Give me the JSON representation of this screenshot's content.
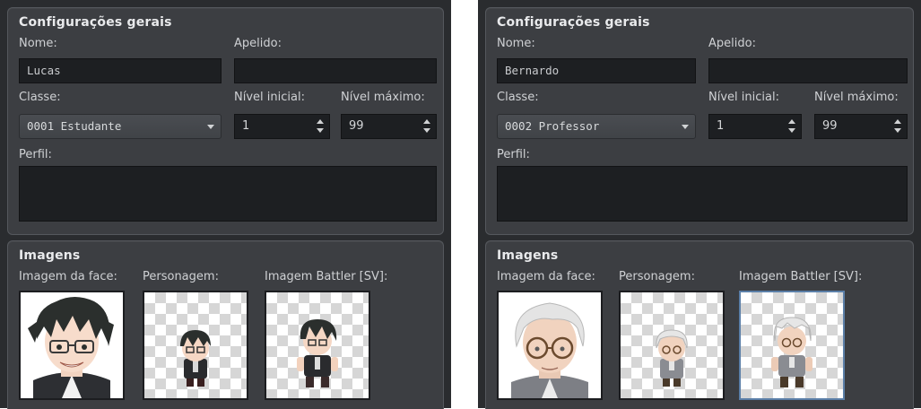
{
  "panels": [
    {
      "general": {
        "title": "Configurações gerais",
        "name_label": "Nome:",
        "name_value": "Lucas",
        "nickname_label": "Apelido:",
        "nickname_value": "",
        "class_label": "Classe:",
        "class_value": "0001 Estudante",
        "initial_level_label": "Nível inicial:",
        "initial_level_value": "1",
        "max_level_label": "Nível máximo:",
        "max_level_value": "99",
        "profile_label": "Perfil:",
        "profile_value": ""
      },
      "images": {
        "title": "Imagens",
        "face_label": "Imagem da face:",
        "character_label": "Personagem:",
        "battler_label": "Imagem Battler [SV]:"
      }
    },
    {
      "general": {
        "title": "Configurações gerais",
        "name_label": "Nome:",
        "name_value": "Bernardo",
        "nickname_label": "Apelido:",
        "nickname_value": "",
        "class_label": "Classe:",
        "class_value": "0002 Professor",
        "initial_level_label": "Nível inicial:",
        "initial_level_value": "1",
        "max_level_label": "Nível máximo:",
        "max_level_value": "99",
        "profile_label": "Perfil:",
        "profile_value": ""
      },
      "images": {
        "title": "Imagens",
        "face_label": "Imagem da face:",
        "character_label": "Personagem:",
        "battler_label": "Imagem Battler [SV]:"
      }
    }
  ],
  "colors": {
    "panel_bg": "#2a2c2f",
    "group_bg": "#3c3e42",
    "field_bg": "#1d1f22",
    "selected_border": "#5b7fa8",
    "lucas_hair": "#2b2f2d",
    "bernardo_hair": "#e4e4e4"
  },
  "icons": [
    "dropdown-arrow-icon",
    "spin-up-icon",
    "spin-down-icon"
  ]
}
